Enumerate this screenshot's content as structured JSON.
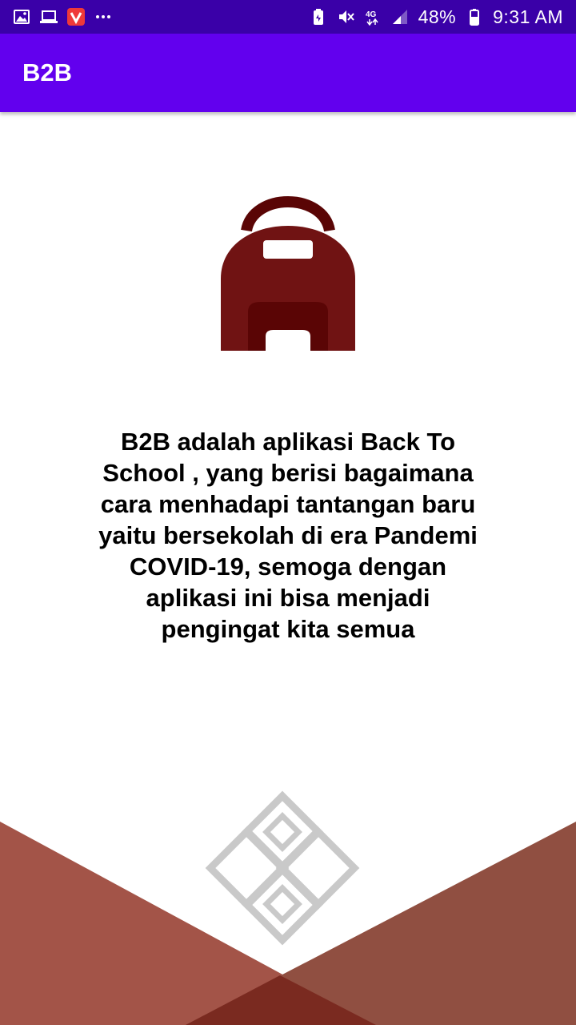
{
  "status_bar": {
    "left_icons": [
      "image-icon",
      "laptop-icon",
      "vivaldi-icon",
      "more-dots-icon"
    ],
    "right_icons": [
      "battery-saver-icon",
      "mute-icon",
      "4g-icon",
      "signal-icon",
      "battery-icon"
    ],
    "network": "4G",
    "battery": "48%",
    "time": "9:31 AM"
  },
  "app_bar": {
    "title": "B2B"
  },
  "main": {
    "illustration": "backpack-icon",
    "description": "B2B adalah aplikasi Back To School , yang berisi bagaimana cara menhadapi tantangan baru yaitu bersekolah di era Pandemi COVID-19, semoga dengan aplikasi ini bisa menjadi pengingat kita semua",
    "bottom_logo": "b2b-logo-icon"
  },
  "colors": {
    "status_bar": "#3a00a8",
    "app_bar": "#6200ee",
    "backpack": "#701313",
    "backpack_dark": "#5a0505",
    "triangle_left": "#a35448",
    "triangle_right": "#904f41",
    "triangle_overlap": "#7a2a20",
    "logo": "#c9c9c9"
  }
}
